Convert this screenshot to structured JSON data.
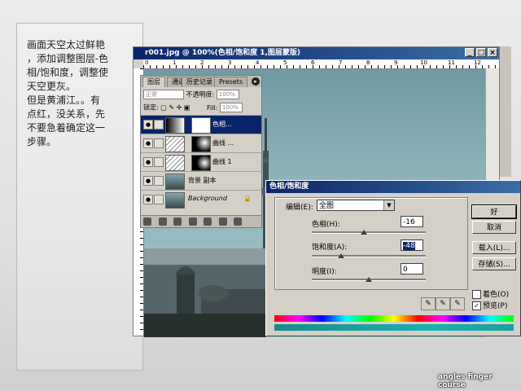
{
  "note": {
    "lines": [
      "画面天空太过鲜艳",
      "，添加调整图层-色",
      "相/饱和度，调整使",
      "天空更灰。",
      "但是黄浦江。。有",
      "点红，没关系，先",
      "不要急着确定这一",
      "步骤。"
    ]
  },
  "document": {
    "title": "r001.jpg @ 100%(色相/饱和度 1,图层蒙版)",
    "buttons": [
      "_",
      "□",
      "×"
    ],
    "ruler_labels": [
      "0",
      "1",
      "2",
      "3",
      "4",
      "5",
      "6",
      "7",
      "8",
      "9",
      "10",
      "11",
      "12"
    ]
  },
  "layers_panel": {
    "tabs": [
      "图层",
      "通道",
      "历史记录",
      "Presets"
    ],
    "blend_mode": "正常",
    "opacity_label": "不透明度:",
    "opacity_value": "100%",
    "lock_label": "锁定:",
    "fill_label": "Fill:",
    "fill_value": "100%",
    "layers": [
      {
        "name": "色相...",
        "selected": true
      },
      {
        "name": "曲线 ...",
        "selected": false
      },
      {
        "name": "曲线 1",
        "selected": false
      },
      {
        "name": "背景 副本",
        "selected": false
      },
      {
        "name": "Background",
        "selected": false
      }
    ]
  },
  "dialog": {
    "title": "色相/饱和度",
    "edit_label": "编辑(E):",
    "edit_value": "全图",
    "hue_label": "色相(H):",
    "hue_value": "-16",
    "hue_fraction": 0.456,
    "saturation_label": "饱和度(A):",
    "saturation_value": "-48",
    "saturation_fraction": 0.26,
    "lightness_label": "明度(I):",
    "lightness_value": "0",
    "lightness_fraction": 0.5,
    "buttons": {
      "ok": "好",
      "cancel": "取消",
      "load": "载入(L)...",
      "save": "存储(S)..."
    },
    "colorize_label": "着色(O)",
    "colorize_checked": false,
    "preview_label": "预览(P)",
    "preview_checked": true
  },
  "credit": "angles finger course"
}
